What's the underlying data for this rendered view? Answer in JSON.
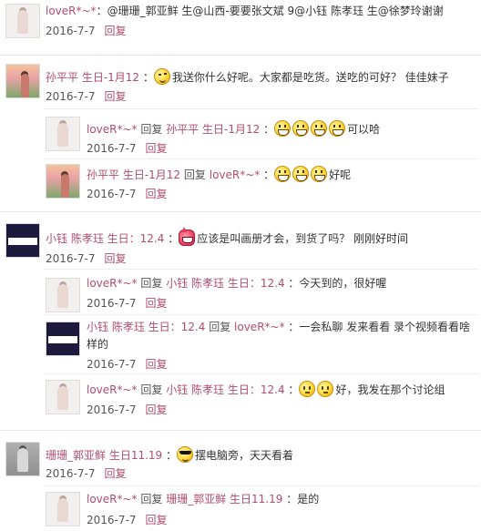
{
  "sep_word": "回复",
  "items": [
    {
      "user": "loveR*~*",
      "text_pre": "：@珊珊_郭亚鲜 生@山西-要要张文斌 9@小钰 陈孝珏 生@徐梦玲谢谢",
      "date": "2016-7-7",
      "reply": "回复"
    },
    {
      "user": "孙平平 生日-1月12",
      "text_pre": "：",
      "emoji": "wink-emoji",
      "text_post": "我送你什么好呢。大家都是吃货。送吃的可好？ 佳佳妹子",
      "date": "2016-7-7",
      "reply": "回复",
      "replies": [
        {
          "user": "loveR*~*",
          "target": "孙平平 生日-1月12",
          "text_pre": "：",
          "emojis": [
            "grin-emoji",
            "grin-emoji",
            "grin-emoji",
            "grin-emoji"
          ],
          "text_post": "可以哈",
          "date": "2016-7-7",
          "reply": "回复"
        },
        {
          "user": "孙平平 生日-1月12",
          "target": "loveR*~*",
          "text_pre": "：",
          "emojis": [
            "grin-emoji",
            "grin-emoji",
            "grin-emoji"
          ],
          "text_post": "好呢",
          "date": "2016-7-7",
          "reply": "回复"
        }
      ]
    },
    {
      "user": "小钰 陈孝珏 生日：12.4",
      "text_pre": "：",
      "emoji": "devil-emoji",
      "text_post": "应该是叫画册才会，到货了吗？ 刚刚好时间",
      "date": "2016-7-7",
      "reply": "回复",
      "replies": [
        {
          "user": "loveR*~*",
          "target": "小钰 陈孝珏 生日：12.4",
          "text_post": "：今天到的，很好喔",
          "date": "2016-7-7",
          "reply": "回复"
        },
        {
          "user": "小钰 陈孝珏 生日：12.4",
          "target": "loveR*~*",
          "text_post": "：一会私聊 发来看看 录个视频看看啥",
          "text_wrap": "样的",
          "date": "2016-7-7",
          "reply": "回复"
        },
        {
          "user": "loveR*~*",
          "target": "小钰 陈孝珏 生日：12.4",
          "text_pre": "：",
          "emojis": [
            "calm-emoji",
            "calm-emoji"
          ],
          "text_post": "好，我发在那个讨论组",
          "date": "2016-7-7",
          "reply": "回复"
        }
      ]
    },
    {
      "user": "珊珊_郭亚鲜 生日11.19",
      "text_pre": "：",
      "emoji": "cool-emoji",
      "text_post": "摆电脑旁，天天看着",
      "date": "2016-7-7",
      "reply": "回复",
      "replies": [
        {
          "user": "loveR*~*",
          "target": "珊珊_郭亚鲜 生日11.19",
          "text_post": "：是的",
          "date": "2016-7-7",
          "reply": "回复"
        }
      ]
    }
  ]
}
